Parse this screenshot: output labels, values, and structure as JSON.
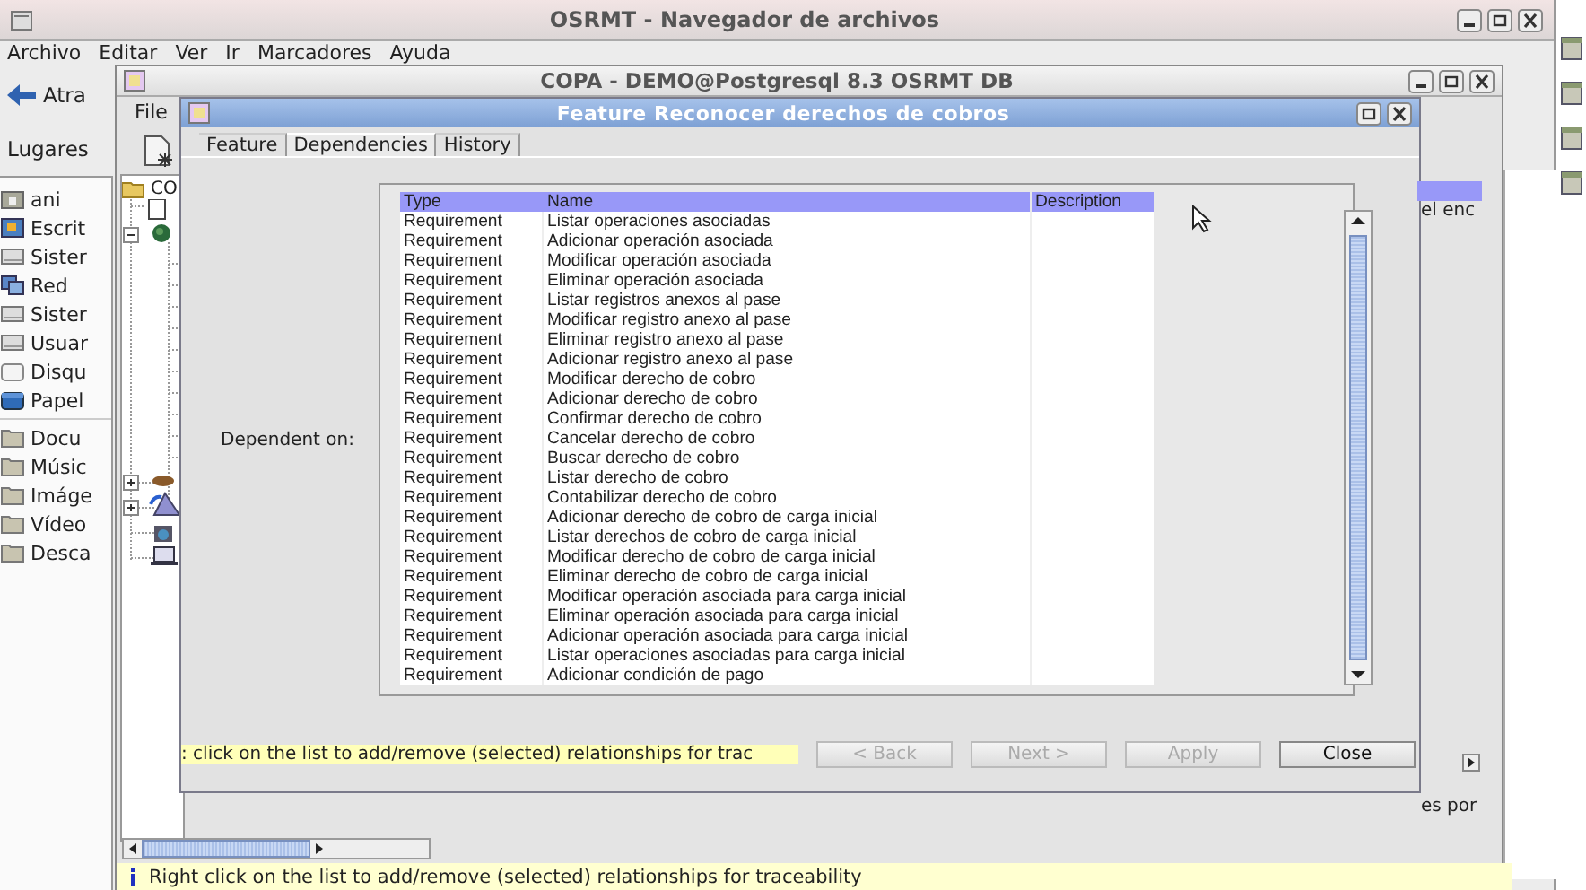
{
  "file_browser": {
    "title": "OSRMT - Navegador de archivos",
    "menu": [
      "Archivo",
      "Editar",
      "Ver",
      "Ir",
      "Marcadores",
      "Ayuda"
    ],
    "back_button": "Atra",
    "places_label": "Lugares",
    "places": [
      {
        "label": "ani",
        "kind": "home"
      },
      {
        "label": "Escrit",
        "kind": "desktop"
      },
      {
        "label": "Sister",
        "kind": "drive"
      },
      {
        "label": "Red",
        "kind": "network"
      },
      {
        "label": "Sister",
        "kind": "drive"
      },
      {
        "label": "Usuar",
        "kind": "drive"
      },
      {
        "label": "Disqu",
        "kind": "floppy"
      },
      {
        "label": "Papel",
        "kind": "trash"
      },
      {
        "label": "Docu",
        "kind": "folder"
      },
      {
        "label": "Músic",
        "kind": "folder"
      },
      {
        "label": "Imáge",
        "kind": "folder"
      },
      {
        "label": "Vídeo",
        "kind": "folder"
      },
      {
        "label": "Desca",
        "kind": "folder"
      }
    ],
    "content_fragments": [
      "el enc",
      "es por"
    ]
  },
  "app_window": {
    "title": "COPA - DEMO@Postgresql 8.3 OSRMT DB",
    "menu": [
      "File"
    ],
    "tree_root": "CO",
    "status": "Right click on the list to add/remove (selected) relationships for traceability"
  },
  "dialog": {
    "title": "Feature Reconocer derechos de cobros",
    "tabs": [
      {
        "label": "Feature",
        "selected": false
      },
      {
        "label": "Dependencies",
        "selected": true
      },
      {
        "label": "History",
        "selected": false
      }
    ],
    "dependent_label": "Dependent on:",
    "table": {
      "columns": [
        "Type",
        "Name",
        "Description"
      ],
      "rows": [
        [
          "Requirement",
          "Listar operaciones asociadas"
        ],
        [
          "Requirement",
          "Adicionar operación asociada"
        ],
        [
          "Requirement",
          "Modificar operación asociada"
        ],
        [
          "Requirement",
          "Eliminar operación asociada"
        ],
        [
          "Requirement",
          "Listar registros anexos al pase"
        ],
        [
          "Requirement",
          "Modificar registro anexo al pase"
        ],
        [
          "Requirement",
          "Eliminar registro anexo al pase"
        ],
        [
          "Requirement",
          "Adicionar registro anexo al pase"
        ],
        [
          "Requirement",
          "Modificar derecho de cobro"
        ],
        [
          "Requirement",
          "Adicionar derecho de cobro"
        ],
        [
          "Requirement",
          "Confirmar derecho de cobro"
        ],
        [
          "Requirement",
          "Cancelar derecho de cobro"
        ],
        [
          "Requirement",
          "Buscar derecho de cobro"
        ],
        [
          "Requirement",
          "Listar derecho de cobro"
        ],
        [
          "Requirement",
          "Contabilizar derecho de cobro"
        ],
        [
          "Requirement",
          "Adicionar derecho de cobro de carga inicial"
        ],
        [
          "Requirement",
          "Listar derechos de cobro de carga inicial"
        ],
        [
          "Requirement",
          "Modificar derecho de cobro de carga inicial"
        ],
        [
          "Requirement",
          "Eliminar derecho de cobro de carga inicial"
        ],
        [
          "Requirement",
          "Modificar operación asociada para carga inicial"
        ],
        [
          "Requirement",
          "Eliminar operación asociada para carga inicial"
        ],
        [
          "Requirement",
          "Adicionar operación asociada para carga inicial"
        ],
        [
          "Requirement",
          "Listar operaciones asociadas para carga inicial"
        ],
        [
          "Requirement",
          "Adicionar condición de pago"
        ]
      ]
    },
    "hint": ": click on the list to add/remove (selected) relationships for trac",
    "buttons": [
      {
        "label": "< Back",
        "disabled": true
      },
      {
        "label": "Next >",
        "disabled": true
      },
      {
        "label": "Apply",
        "disabled": true
      },
      {
        "label": "Close",
        "disabled": false
      }
    ]
  }
}
